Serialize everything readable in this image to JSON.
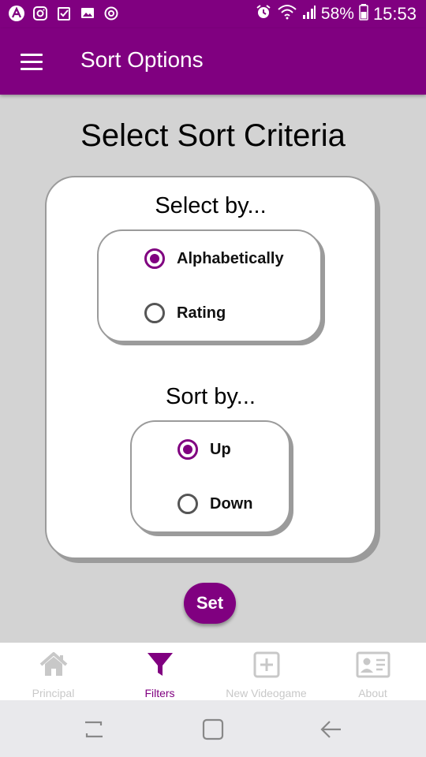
{
  "status_bar": {
    "battery": "58%",
    "time": "15:53",
    "icons": [
      "app-a-icon",
      "instagram-icon",
      "checkbox-icon",
      "image-icon",
      "sync-icon",
      "alarm-icon",
      "wifi-icon",
      "signal-icon",
      "battery-icon"
    ]
  },
  "app_bar": {
    "title": "Sort Options",
    "menu_icon": "hamburger-menu-icon"
  },
  "page": {
    "title": "Select Sort Criteria",
    "select_by": {
      "label": "Select by...",
      "options": [
        {
          "label": "Alphabetically",
          "checked": true
        },
        {
          "label": "Rating",
          "checked": false
        }
      ]
    },
    "sort_by": {
      "label": "Sort by...",
      "options": [
        {
          "label": "Up",
          "checked": true
        },
        {
          "label": "Down",
          "checked": false
        }
      ]
    },
    "set_button": "Set"
  },
  "tabs": [
    {
      "label": "Principal",
      "icon": "home-icon",
      "active": false
    },
    {
      "label": "Filters",
      "icon": "filter-icon",
      "active": true
    },
    {
      "label": "New Videogame",
      "icon": "add-box-icon",
      "active": false
    },
    {
      "label": "About",
      "icon": "contact-card-icon",
      "active": false
    }
  ],
  "colors": {
    "primary": "#800080",
    "background": "#d3d3d3",
    "inactive_tab": "#c8c8c8"
  }
}
